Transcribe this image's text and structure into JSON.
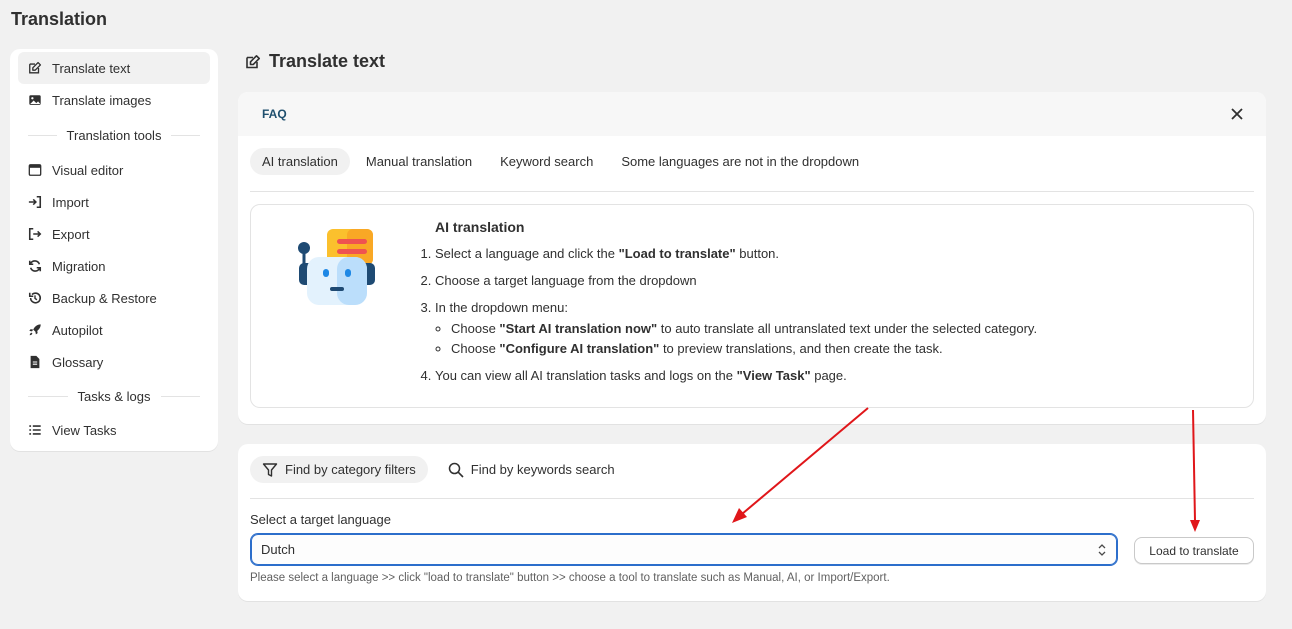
{
  "page": {
    "title": "Translation"
  },
  "sidebar": {
    "items": [
      {
        "label": "Translate text",
        "icon": "edit-icon"
      },
      {
        "label": "Translate images",
        "icon": "image-icon"
      }
    ],
    "section1": "Translation tools",
    "tools": [
      {
        "label": "Visual editor",
        "icon": "window-icon"
      },
      {
        "label": "Import",
        "icon": "import-icon"
      },
      {
        "label": "Export",
        "icon": "export-icon"
      },
      {
        "label": "Migration",
        "icon": "refresh-icon"
      },
      {
        "label": "Backup & Restore",
        "icon": "history-icon"
      },
      {
        "label": "Autopilot",
        "icon": "rocket-icon"
      },
      {
        "label": "Glossary",
        "icon": "document-icon"
      }
    ],
    "section2": "Tasks & logs",
    "tasks": [
      {
        "label": "View Tasks",
        "icon": "list-icon"
      }
    ]
  },
  "main": {
    "title": "Translate text",
    "faq": {
      "label": "FAQ",
      "tabs": [
        "AI translation",
        "Manual translation",
        "Keyword search",
        "Some languages are not in the dropdown"
      ],
      "heading": "AI translation",
      "step1_pre": "Select a language and click the ",
      "step1_bold": "\"Load to translate\"",
      "step1_post": " button.",
      "step2": "Choose a target language from the dropdown",
      "step3": "In the dropdown menu:",
      "bullet1_pre": "Choose ",
      "bullet1_bold": "\"Start AI translation now\"",
      "bullet1_post": " to auto translate all untranslated text under the selected category.",
      "bullet2_pre": "Choose ",
      "bullet2_bold": "\"Configure AI translation\"",
      "bullet2_post": " to preview translations, and then create the task.",
      "step4_pre": "You can view all AI translation tasks and logs on the ",
      "step4_bold": "\"View Task\"",
      "step4_post": " page."
    },
    "filters": {
      "tab1": "Find by category filters",
      "tab2": "Find by keywords search",
      "language_label": "Select a target language",
      "language_value": "Dutch",
      "load_button": "Load to translate",
      "hint": "Please select a language >> click \"load to translate\" button >> choose a tool to translate such as Manual, AI, or Import/Export."
    }
  },
  "colors": {
    "annotation_arrow": "#e0161a",
    "focus_blue": "#2c6ecb",
    "faq_label": "#1f4f6e"
  }
}
